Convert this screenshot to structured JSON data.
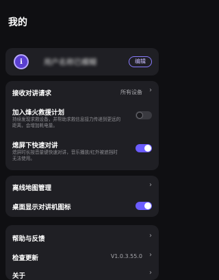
{
  "page": {
    "title": "我的"
  },
  "profile": {
    "avatar_letter": "i",
    "name": "用户名称已模糊",
    "edit_label": "编辑"
  },
  "section1": {
    "receive": {
      "title": "接收对讲请求",
      "value": "所有设备"
    },
    "rescue": {
      "title": "加入烽火救援计划",
      "desc": "持续发现求救设备，并帮助求救信息接力传递到更远的距离，会增加耗电量。",
      "enabled": false
    },
    "lock_screen": {
      "title": "熄屏下快速对讲",
      "desc": "熄屏时长按音量键快速对讲，音乐播放/红外被遮挡时无法使用。",
      "enabled": true
    }
  },
  "section2": {
    "offline_map": {
      "title": "离线地图管理"
    },
    "desktop_icon": {
      "title": "桌面显示对讲机图标",
      "enabled": true
    }
  },
  "section3": {
    "help": {
      "title": "帮助与反馈"
    },
    "update": {
      "title": "检查更新",
      "value": "V1.0.3.55.0"
    },
    "about": {
      "title": "关于"
    }
  },
  "colors": {
    "accent": "#6b5cff",
    "background": "#0f0f12",
    "card": "#1f1f24"
  }
}
